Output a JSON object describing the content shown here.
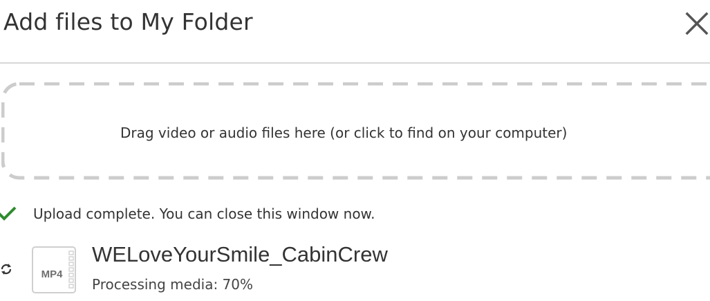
{
  "dialog": {
    "title": "Add files to My Folder",
    "close_icon": "close-icon"
  },
  "dropzone": {
    "text": "Drag video or audio files here (or click to find on your computer)"
  },
  "status": {
    "icon": "checkmark-icon",
    "text": "Upload complete. You can close this window now.",
    "color": "#2e8b2e"
  },
  "files": [
    {
      "name": "WELoveYourSmile_CabinCrew",
      "extension": "MP4",
      "progress_text": "Processing media: 70%",
      "progress_percent": 70,
      "status_icon": "refresh-icon"
    }
  ]
}
